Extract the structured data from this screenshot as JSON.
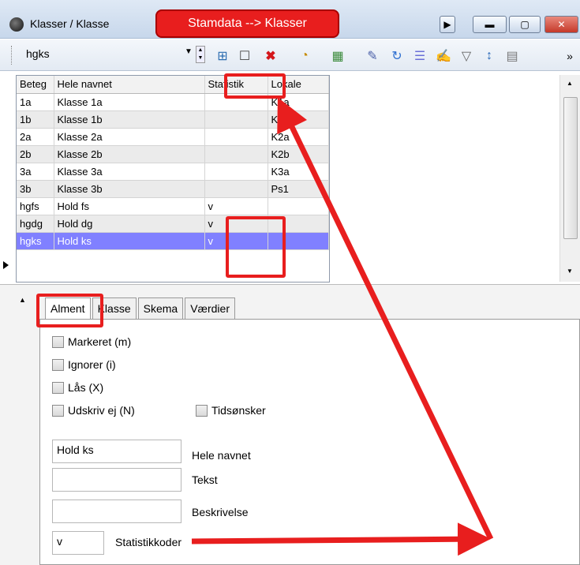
{
  "window": {
    "title": "Klasser / Klasse",
    "callout": "Stamdata --> Klasser"
  },
  "toolbar": {
    "combo_value": "hgks"
  },
  "grid": {
    "columns": [
      "Beteg",
      "Hele navnet",
      "Statistik",
      "Lokale"
    ],
    "rows": [
      [
        "1a",
        "Klasse 1a",
        "",
        "K1a"
      ],
      [
        "1b",
        "Klasse 1b",
        "",
        "K1b"
      ],
      [
        "2a",
        "Klasse 2a",
        "",
        "K2a"
      ],
      [
        "2b",
        "Klasse 2b",
        "",
        "K2b"
      ],
      [
        "3a",
        "Klasse 3a",
        "",
        "K3a"
      ],
      [
        "3b",
        "Klasse 3b",
        "",
        "Ps1"
      ],
      [
        "hgfs",
        "Hold fs",
        "v",
        ""
      ],
      [
        "hgdg",
        "Hold dg",
        "v",
        ""
      ],
      [
        "hgks",
        "Hold ks",
        "v",
        ""
      ]
    ]
  },
  "tabs": [
    "Alment",
    "Klasse",
    "Skema",
    "Værdier"
  ],
  "form": {
    "checkboxes": [
      "Markeret (m)",
      "Ignorer (i)",
      "Lås (X)",
      "Udskriv ej (N)",
      "Tidsønsker"
    ],
    "hele_navnet_value": "Hold ks",
    "hele_navnet_label": "Hele navnet",
    "tekst_label": "Tekst",
    "beskrivelse_label": "Beskrivelse",
    "statistik_value": "v",
    "statistik_label": "Statistikkoder"
  }
}
